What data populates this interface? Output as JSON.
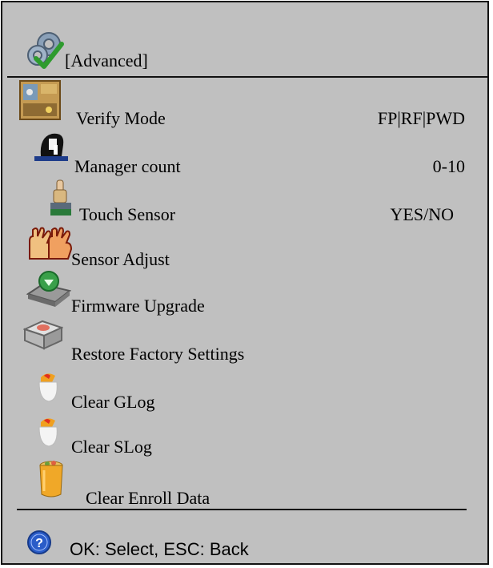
{
  "screen": {
    "title": "[Advanced]",
    "menu": [
      {
        "label": "Verify Mode",
        "value": "FP|RF|PWD",
        "icon": "verify-mode-icon"
      },
      {
        "label": "Manager count",
        "value": "0-10",
        "icon": "manager-icon"
      },
      {
        "label": "Touch Sensor",
        "value": "YES/NO",
        "icon": "touch-sensor-icon"
      },
      {
        "label": "Sensor Adjust",
        "value": "",
        "icon": "hand-icon"
      },
      {
        "label": "Firmware Upgrade",
        "value": "",
        "icon": "firmware-icon"
      },
      {
        "label": "Restore Factory Settings",
        "value": "",
        "icon": "restore-icon"
      },
      {
        "label": "Clear GLog",
        "value": "",
        "icon": "eraser-icon"
      },
      {
        "label": "Clear SLog",
        "value": "",
        "icon": "eraser-icon"
      },
      {
        "label": "Clear Enroll Data",
        "value": "",
        "icon": "trash-icon"
      }
    ],
    "footer": "OK: Select, ESC: Back"
  }
}
